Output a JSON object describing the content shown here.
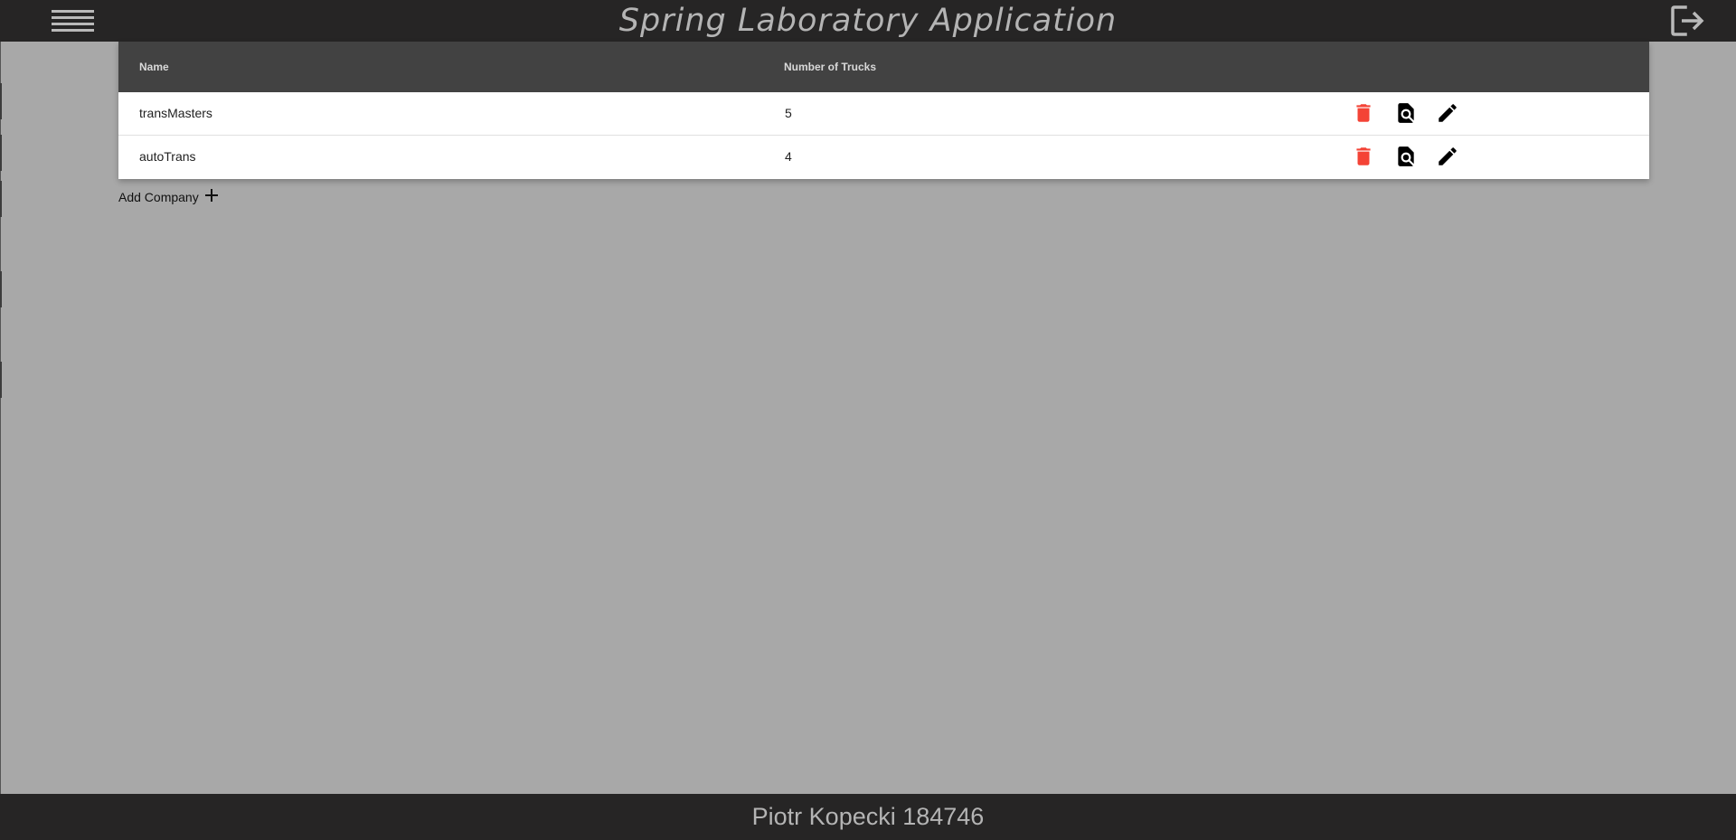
{
  "header": {
    "title": "Spring Laboratory Application",
    "menu_icon": "hamburger-menu-icon",
    "logout_icon": "logout-icon"
  },
  "table": {
    "columns": [
      "Name",
      "Number of Trucks"
    ],
    "rows": [
      {
        "name": "transMasters",
        "trucks": "5"
      },
      {
        "name": "autoTrans",
        "trucks": "4"
      }
    ],
    "actions": [
      "delete-icon",
      "view-details-icon",
      "edit-icon"
    ]
  },
  "add_company": {
    "label": "Add Company",
    "icon": "plus-icon"
  },
  "footer": {
    "text": "Piotr Kopecki 184746"
  },
  "colors": {
    "header_bg": "#262525",
    "page_bg": "#a8a8a8",
    "table_head_bg": "#424242",
    "delete": "#f44336"
  }
}
